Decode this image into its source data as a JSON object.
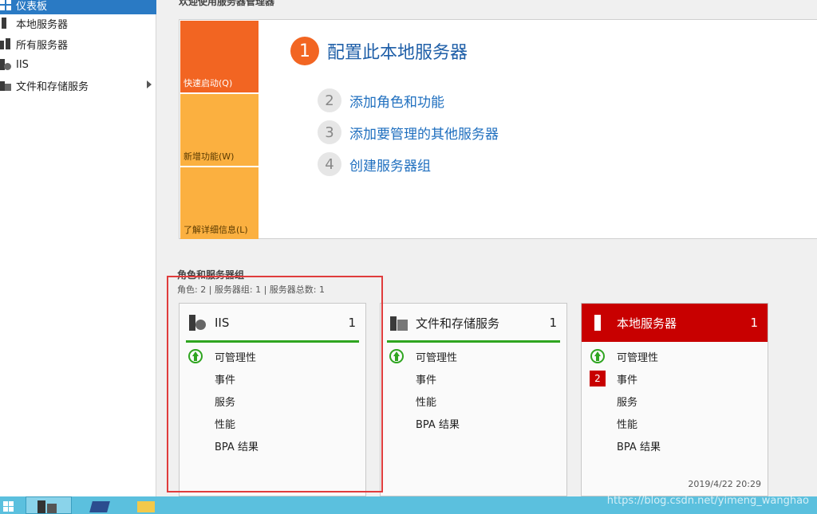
{
  "sidebar": {
    "items": [
      {
        "label": "仪表板",
        "icon": "dashboard-icon",
        "active": true
      },
      {
        "label": "本地服务器",
        "icon": "server-icon"
      },
      {
        "label": "所有服务器",
        "icon": "servers-icon"
      },
      {
        "label": "IIS",
        "icon": "iis-icon"
      },
      {
        "label": "文件和存储服务",
        "icon": "storage-icon",
        "has_children": true
      }
    ]
  },
  "welcome": {
    "title": "欢迎使用服务器管理器",
    "tiles": [
      "快速启动(Q)",
      "新增功能(W)",
      "了解详细信息(L)"
    ],
    "steps": [
      {
        "num": "1",
        "label": "配置此本地服务器"
      },
      {
        "num": "2",
        "label": "添加角色和功能"
      },
      {
        "num": "3",
        "label": "添加要管理的其他服务器"
      },
      {
        "num": "4",
        "label": "创建服务器组"
      }
    ]
  },
  "roles": {
    "title": "角色和服务器组",
    "summary": "角色: 2 | 服务器组: 1 | 服务器总数: 1",
    "cards": [
      {
        "title": "IIS",
        "count": "1",
        "rows": [
          "可管理性",
          "事件",
          "服务",
          "性能",
          "BPA 结果"
        ]
      },
      {
        "title": "文件和存储服务",
        "count": "1",
        "rows": [
          "可管理性",
          "事件",
          "性能",
          "BPA 结果"
        ]
      },
      {
        "title": "本地服务器",
        "count": "1",
        "rows": [
          "可管理性",
          "事件",
          "服务",
          "性能",
          "BPA 结果"
        ],
        "event_badge": "2",
        "timestamp": "2019/4/22 20:29"
      }
    ]
  },
  "colors": {
    "accent": "#2a7ac4",
    "orange": "#f26522",
    "amber": "#fbb040",
    "ok": "#2fa520",
    "alert": "#c80000"
  },
  "watermark": "https://blog.csdn.net/yimeng_wanghao"
}
